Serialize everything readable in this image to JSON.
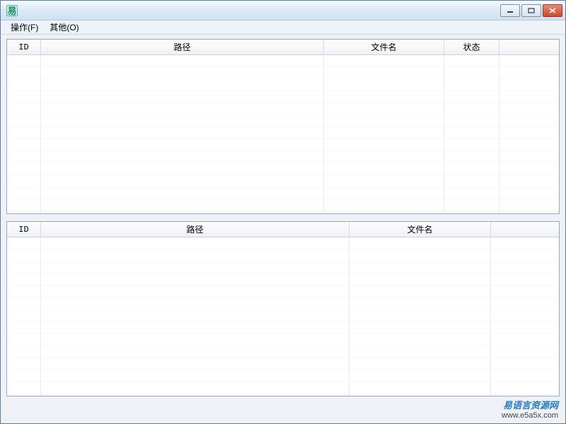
{
  "titlebar": {
    "icon_label": "易"
  },
  "menubar": {
    "op_label": "操作(F)",
    "other_label": "其他(O)"
  },
  "listview_top": {
    "columns": {
      "id": "ID",
      "path": "路径",
      "filename": "文件名",
      "status": "状态"
    }
  },
  "listview_bottom": {
    "columns": {
      "id": "ID",
      "path": "路径",
      "filename": "文件名"
    }
  },
  "watermark": {
    "line1": "易语言资源网",
    "line2": "www.e5a5x.com"
  }
}
